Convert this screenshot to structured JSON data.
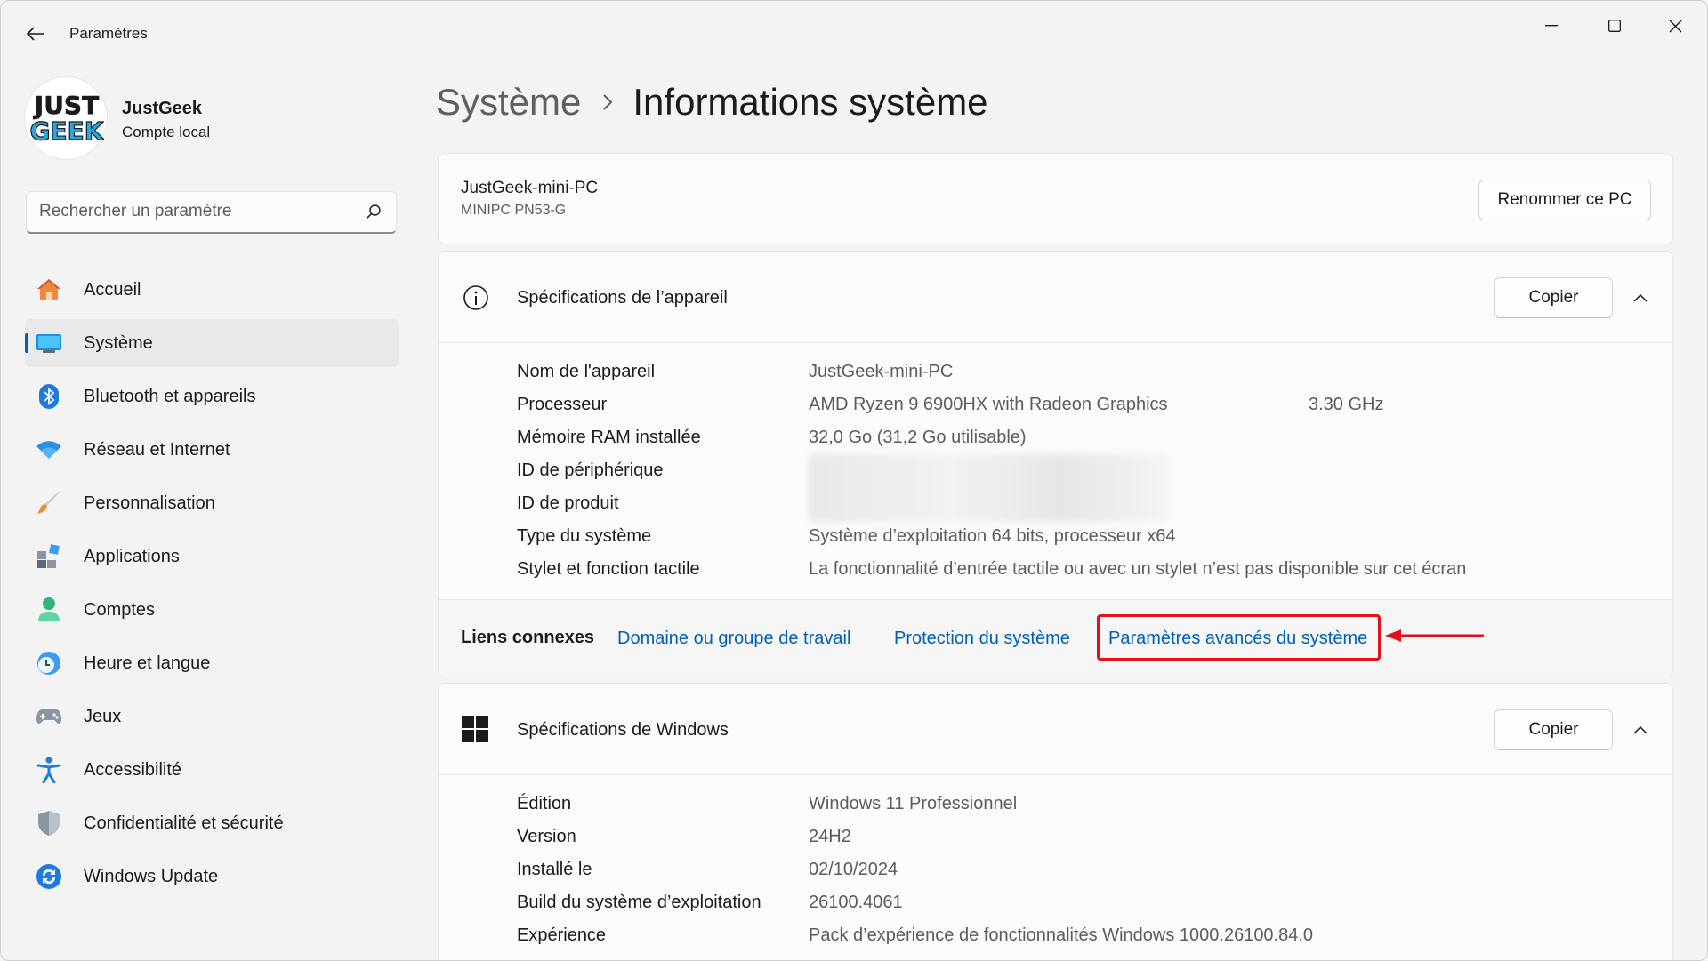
{
  "titlebar": {
    "title": "Paramètres"
  },
  "user": {
    "name": "JustGeek",
    "type": "Compte local",
    "avatar_text_top": "JUST",
    "avatar_text_bottom": "GEEK"
  },
  "search": {
    "placeholder": "Rechercher un paramètre",
    "value": ""
  },
  "sidebar": {
    "items": [
      {
        "label": "Accueil",
        "icon": "home-icon",
        "active": false
      },
      {
        "label": "Système",
        "icon": "system-icon",
        "active": true
      },
      {
        "label": "Bluetooth et appareils",
        "icon": "bluetooth-icon",
        "active": false
      },
      {
        "label": "Réseau et Internet",
        "icon": "wifi-icon",
        "active": false
      },
      {
        "label": "Personnalisation",
        "icon": "brush-icon",
        "active": false
      },
      {
        "label": "Applications",
        "icon": "apps-icon",
        "active": false
      },
      {
        "label": "Comptes",
        "icon": "account-icon",
        "active": false
      },
      {
        "label": "Heure et langue",
        "icon": "clock-globe-icon",
        "active": false
      },
      {
        "label": "Jeux",
        "icon": "gamepad-icon",
        "active": false
      },
      {
        "label": "Accessibilité",
        "icon": "accessibility-icon",
        "active": false
      },
      {
        "label": "Confidentialité et sécurité",
        "icon": "shield-icon",
        "active": false
      },
      {
        "label": "Windows Update",
        "icon": "update-icon",
        "active": false
      }
    ]
  },
  "breadcrumb": {
    "parent": "Système",
    "current": "Informations système"
  },
  "pc": {
    "name": "JustGeek-mini-PC",
    "model": "MINIPC PN53-G",
    "rename_label": "Renommer ce PC"
  },
  "device_specs": {
    "title": "Spécifications de l’appareil",
    "copy_label": "Copier",
    "rows": [
      {
        "label": "Nom de l'appareil",
        "value": "JustGeek-mini-PC"
      },
      {
        "label": "Processeur",
        "value": "AMD Ryzen 9 6900HX with Radeon Graphics",
        "extra": "3.30 GHz"
      },
      {
        "label": "Mémoire RAM installée",
        "value": "32,0 Go (31,2 Go utilisable)"
      },
      {
        "label": "ID de périphérique",
        "value": ""
      },
      {
        "label": "ID de produit",
        "value": ""
      },
      {
        "label": "Type du système",
        "value": "Système d’exploitation 64 bits, processeur x64"
      },
      {
        "label": "Stylet et fonction tactile",
        "value": "La fonctionnalité d’entrée tactile ou avec un stylet n’est pas disponible sur cet écran"
      }
    ]
  },
  "related_links": {
    "label": "Liens connexes",
    "links": [
      "Domaine ou groupe de travail",
      "Protection du système",
      "Paramètres avancés du système"
    ]
  },
  "windows_specs": {
    "title": "Spécifications de Windows",
    "copy_label": "Copier",
    "rows": [
      {
        "label": "Édition",
        "value": "Windows 11 Professionnel"
      },
      {
        "label": "Version",
        "value": "24H2"
      },
      {
        "label": "Installé le",
        "value": "02/10/2024"
      },
      {
        "label": "Build du système d’exploitation",
        "value": "26100.4061"
      },
      {
        "label": "Expérience",
        "value": "Pack d’expérience de fonctionnalités Windows 1000.26100.84.0"
      }
    ]
  },
  "colors": {
    "accent": "#005fb8",
    "highlight": "#e0121b"
  }
}
